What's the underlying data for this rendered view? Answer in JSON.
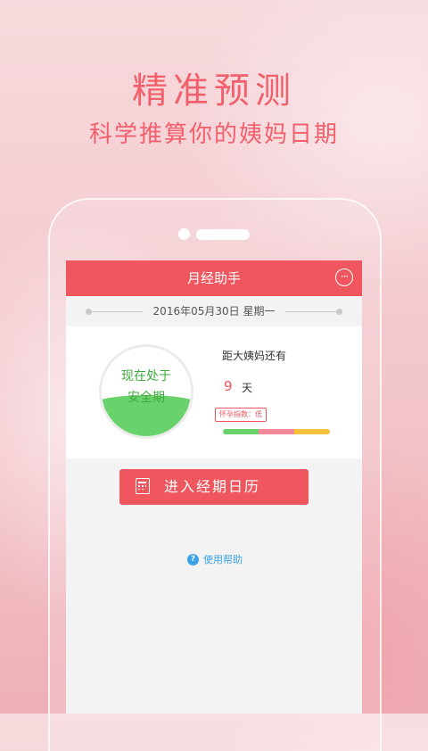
{
  "promo": {
    "title": "精准预测",
    "subtitle": "科学推算你的姨妈日期"
  },
  "app": {
    "title": "月经助手",
    "more_icon": "more-icon",
    "date_text": "2016年05月30日 星期一",
    "status": {
      "line1": "现在处于",
      "line2": "安全期",
      "fill_level": 0.34
    },
    "countdown": {
      "label": "距大姨妈还有",
      "days": "9",
      "unit": "天"
    },
    "pregnancy_index": {
      "label": "怀孕指数：低",
      "segments": [
        "green",
        "pink",
        "yellow"
      ]
    },
    "calendar_button": {
      "label": "进入经期日历",
      "icon": "calendar-icon"
    },
    "help": {
      "label": "使用帮助",
      "icon": "question-icon"
    }
  },
  "colors": {
    "accent": "#f0565e",
    "promo_text": "#f2606c",
    "safe": "#6ad26a",
    "help": "#3aa3e8"
  }
}
